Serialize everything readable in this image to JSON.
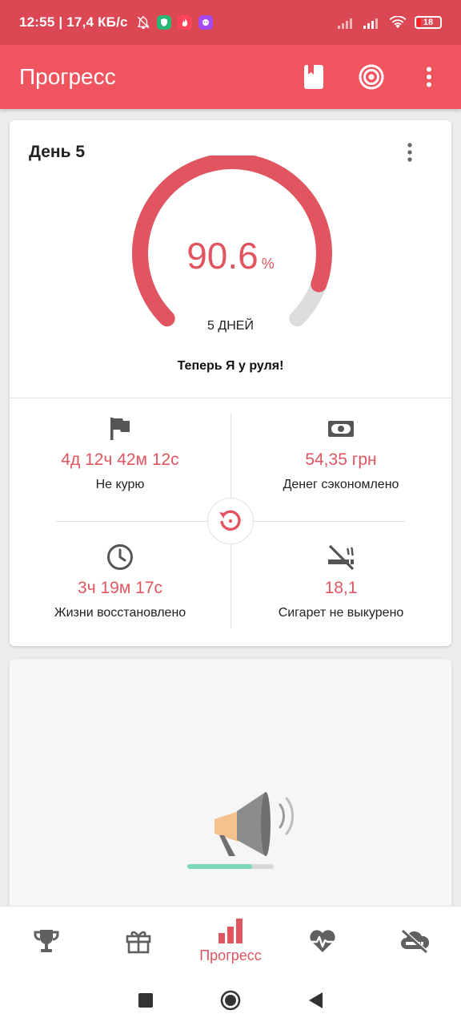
{
  "status_bar": {
    "text": "12:55 | 17,4 КБ/с",
    "battery": "18"
  },
  "app_bar": {
    "title": "Прогресс",
    "icons": [
      "bookmark-icon",
      "target-icon",
      "more-vert-icon"
    ]
  },
  "progress_card": {
    "day_title": "День 5",
    "gauge": {
      "value": "90.6",
      "unit": "%",
      "fraction": 0.906,
      "days_label": "5 ДНЕЙ"
    },
    "motto": "Теперь Я у руля!",
    "stats": [
      {
        "icon": "flag-icon",
        "value": "4д 12ч 42м 12с",
        "label": "Не курю"
      },
      {
        "icon": "money-icon",
        "value": "54,35 грн",
        "label": "Денег сэкономлено"
      },
      {
        "icon": "clock-icon",
        "value": "3ч 19м 17с",
        "label": "Жизни восстановлено"
      },
      {
        "icon": "no-smoking-icon",
        "value": "18,1",
        "label": "Сигарет не выкурено"
      }
    ]
  },
  "ad_card": {
    "loading_progress": 0.75
  },
  "bottom_nav": {
    "items": [
      {
        "icon": "trophy-icon",
        "label": ""
      },
      {
        "icon": "gift-icon",
        "label": ""
      },
      {
        "icon": "bar-chart-icon",
        "label": "Прогресс",
        "active": true
      },
      {
        "icon": "heartbeat-icon",
        "label": ""
      },
      {
        "icon": "no-cigarette-cloud-icon",
        "label": ""
      }
    ]
  },
  "colors": {
    "status_bar": "#db4753",
    "app_bar": "#f0555f",
    "accent": "#e05560",
    "gauge_track": "#dddddd"
  }
}
